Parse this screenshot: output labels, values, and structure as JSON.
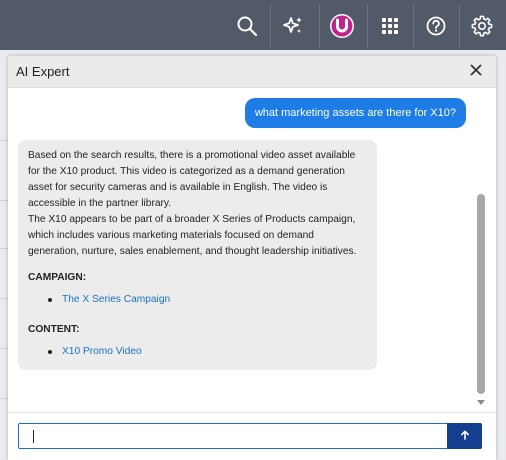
{
  "topbar": {
    "background": "#525a67",
    "icons": [
      "search-icon",
      "ai-sparkle-icon",
      "brand-u-icon",
      "apps-grid-icon",
      "help-icon",
      "settings-gear-icon"
    ],
    "brand_letter": "U",
    "brand_color": "#c0248e"
  },
  "panel": {
    "title": "AI Expert",
    "close_icon": "close-icon"
  },
  "chat": {
    "user_message": "what marketing assets are there for X10?",
    "ai_response": {
      "paragraph1": "Based on the search results, there is a promotional video asset available for the X10 product. This video is categorized as a demand generation asset for security cameras and is available in English. The video is accessible in the partner library.",
      "paragraph2": "The X10 appears to be part of a broader X Series of Products campaign, which includes various marketing materials focused on demand generation, nurture, sales enablement, and thought leadership initiatives.",
      "campaign_heading": "CAMPAIGN:",
      "campaign_items": [
        "The X Series Campaign"
      ],
      "content_heading": "CONTENT:",
      "content_items": [
        "X10 Promo Video"
      ]
    }
  },
  "composer": {
    "input_value": "",
    "send_icon": "arrow-up-icon"
  },
  "colors": {
    "user_bubble": "#1d7ce6",
    "ai_bubble": "#ececec",
    "link": "#1a72c2",
    "send_button": "#143e8f"
  }
}
